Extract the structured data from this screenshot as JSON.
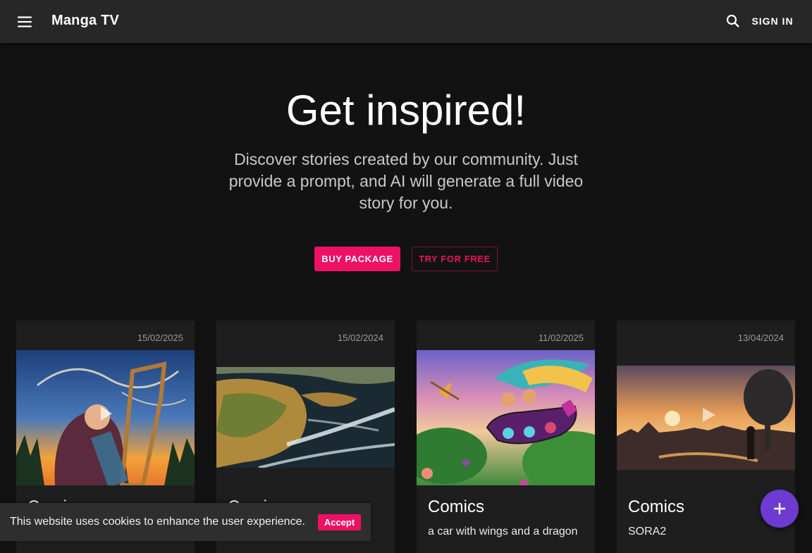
{
  "header": {
    "title": "Manga TV",
    "menu_icon": "menu-icon",
    "search_icon": "search-icon",
    "sign_in_label": "SIGN IN"
  },
  "hero": {
    "title": "Get inspired!",
    "subtitle": "Discover stories created by our community. Just provide a prompt, and AI will generate a full video story for you.",
    "buy_label": "BUY PACKAGE",
    "try_label": "TRY FOR FREE"
  },
  "cards": [
    {
      "date": "15/02/2025",
      "title": "Comics",
      "description": ""
    },
    {
      "date": "15/02/2024",
      "title": "Comics",
      "description": ""
    },
    {
      "date": "11/02/2025",
      "title": "Comics",
      "description": "a car with wings and a dragon"
    },
    {
      "date": "13/04/2024",
      "title": "Comics",
      "description": "SORA2"
    }
  ],
  "cookie": {
    "text": "This website uses cookies to enhance the user experience.",
    "accept_label": "Accept"
  },
  "fab_icon": "plus-icon",
  "colors": {
    "accent": "#ec1164",
    "fab": "#6d3bd1",
    "appbar": "#272727",
    "background": "#121212",
    "card": "#1e1e1e"
  }
}
